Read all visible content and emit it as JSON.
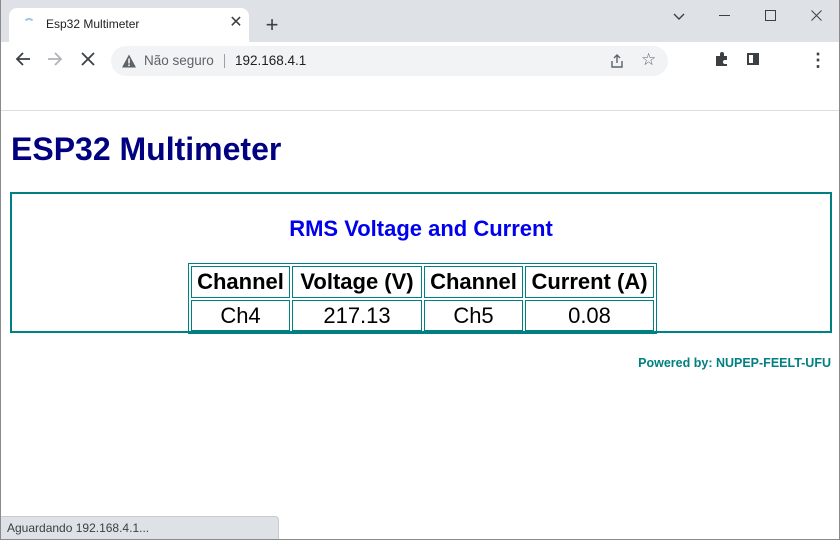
{
  "browser": {
    "tab_title": "Esp32 Multimeter",
    "security_label": "Não seguro",
    "url": "192.168.4.1",
    "status_text": "Aguardando 192.168.4.1..."
  },
  "page": {
    "title": "ESP32 Multimeter",
    "panel_heading": "RMS Voltage and Current",
    "table": {
      "headers": [
        "Channel",
        "Voltage (V)",
        "Channel",
        "Current (A)"
      ],
      "row": [
        "Ch4",
        "217.13",
        "Ch5",
        "0.08"
      ]
    },
    "footer": "Powered by: NUPEP-FEELT-UFU"
  },
  "colors": {
    "title": "#000080",
    "heading": "#0000EE",
    "border": "#008080",
    "footer": "#008080"
  },
  "icons": {
    "back": "arrow-left-icon",
    "forward": "arrow-right-icon",
    "stop": "close-icon",
    "security": "warning-icon",
    "share": "share-icon",
    "bookmark": "star-icon",
    "extensions": "puzzle-icon",
    "side_panel": "side-panel-icon",
    "menu": "kebab-menu-icon"
  }
}
